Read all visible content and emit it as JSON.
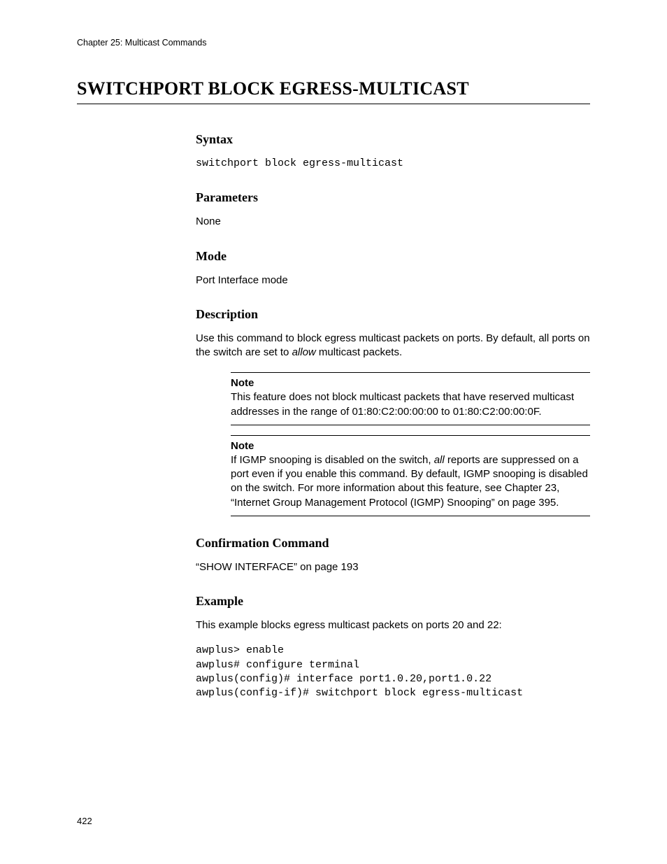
{
  "header": {
    "running": "Chapter 25: Multicast Commands"
  },
  "title": "SWITCHPORT BLOCK EGRESS-MULTICAST",
  "sections": {
    "syntax": {
      "heading": "Syntax",
      "code": "switchport block egress-multicast"
    },
    "parameters": {
      "heading": "Parameters",
      "text": "None"
    },
    "mode": {
      "heading": "Mode",
      "text": "Port Interface mode"
    },
    "description": {
      "heading": "Description",
      "text_pre": "Use this command to block egress multicast packets on ports. By default, all ports on the switch are set to ",
      "text_italic": "allow",
      "text_post": " multicast packets.",
      "note1": {
        "label": "Note",
        "body": "This feature does not block multicast packets that have reserved multicast addresses in the range of 01:80:C2:00:00:00 to 01:80:C2:00:00:0F."
      },
      "note2": {
        "label": "Note",
        "body_pre": "If IGMP snooping is disabled on the switch, ",
        "body_italic": "all",
        "body_post": " reports are suppressed on a port even if you enable this command. By default, IGMP snooping is disabled on the switch. For more information about this feature, see Chapter 23, “Internet Group Management Protocol (IGMP) Snooping” on page 395."
      }
    },
    "confirmation": {
      "heading": "Confirmation Command",
      "text": "“SHOW INTERFACE” on page 193"
    },
    "example": {
      "heading": "Example",
      "text": "This example blocks egress multicast packets on ports 20 and 22:",
      "code": "awplus> enable\nawplus# configure terminal\nawplus(config)# interface port1.0.20,port1.0.22\nawplus(config-if)# switchport block egress-multicast"
    }
  },
  "page_number": "422"
}
